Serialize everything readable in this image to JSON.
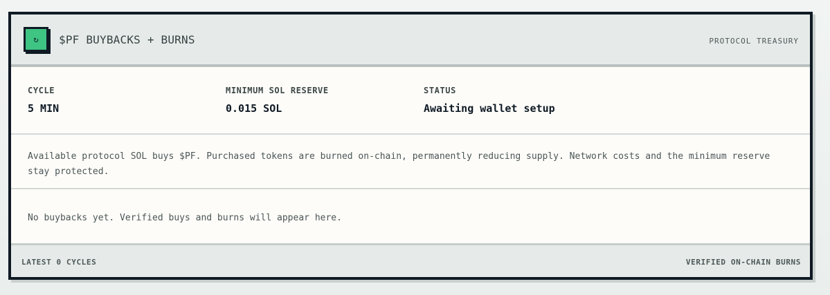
{
  "header": {
    "logo_glyph": "↻",
    "logo_color": "#3ec483",
    "title": "$PF BUYBACKS + BURNS",
    "meta": "PROTOCOL TREASURY"
  },
  "stats": [
    {
      "label": "CYCLE",
      "value": "5 MIN"
    },
    {
      "label": "MINIMUM SOL RESERVE",
      "value": "0.015 SOL"
    },
    {
      "label": "STATUS",
      "value": "Awaiting wallet setup"
    }
  ],
  "description": "Available protocol SOL buys $PF. Purchased tokens are burned on-chain, permanently reducing supply. Network costs and the minimum reserve stay protected.",
  "empty_state": "No buybacks yet. Verified buys and burns will appear here.",
  "footer": {
    "left": "LATEST 0 CYCLES",
    "right": "VERIFIED ON-CHAIN BURNS"
  },
  "colors": {
    "border": "#0f1a24",
    "accent": "#3ec483",
    "header_bg": "#e6ebea",
    "body_bg": "#fdfcf9"
  }
}
